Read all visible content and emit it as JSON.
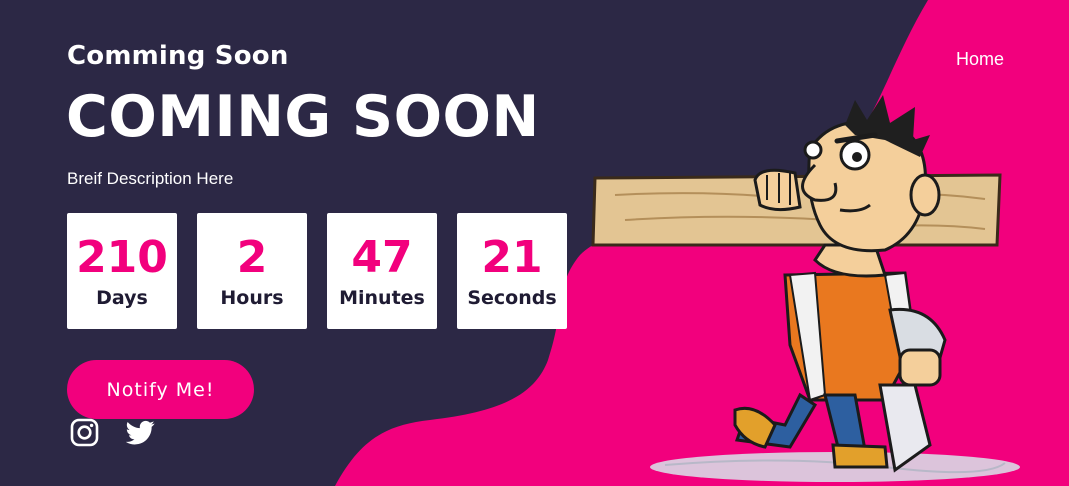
{
  "header": {
    "brand": "Comming Soon",
    "nav": {
      "home": "Home"
    }
  },
  "hero": {
    "title": "COMING SOON",
    "description": "Breif Description Here",
    "countdown": [
      {
        "value": "210",
        "label": "Days"
      },
      {
        "value": "2",
        "label": "Hours"
      },
      {
        "value": "47",
        "label": "Minutes"
      },
      {
        "value": "21",
        "label": "Seconds"
      }
    ],
    "cta_label": "Notify Me!"
  },
  "social": [
    {
      "icon": "instagram-icon"
    },
    {
      "icon": "twitter-icon"
    }
  ],
  "illustration": {
    "icon": "carpenter-mascot-illustration"
  },
  "colors": {
    "background": "#2c2845",
    "accent": "#f2007d",
    "card": "#ffffff",
    "card_label": "#1f1b33"
  }
}
